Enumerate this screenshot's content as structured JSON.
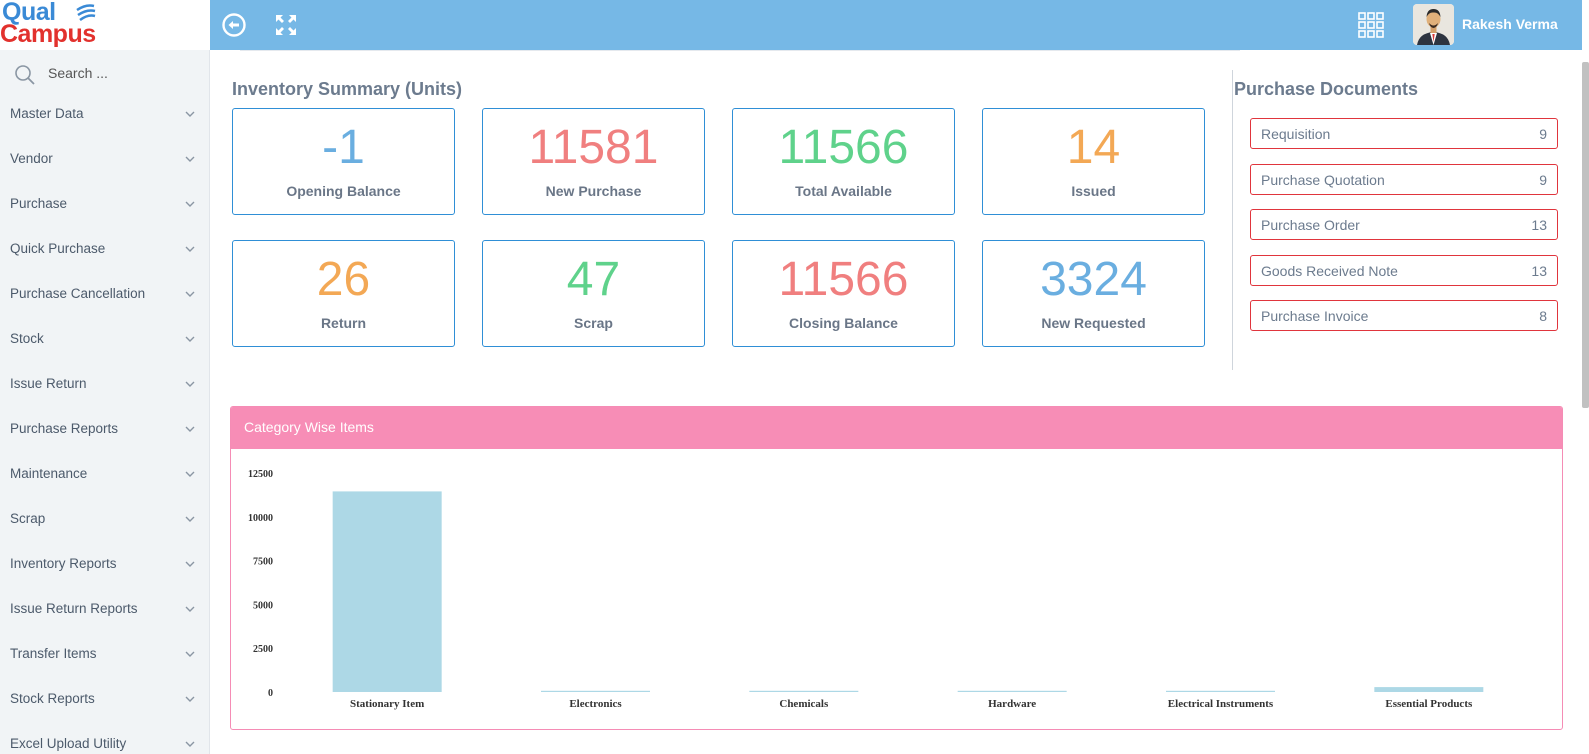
{
  "brand": {
    "line1": "Qual",
    "line2": "Campus"
  },
  "topbar": {
    "user_name": "Rakesh Verma"
  },
  "sidebar": {
    "search_placeholder": "Search ...",
    "items": [
      {
        "label": "Master Data"
      },
      {
        "label": "Vendor"
      },
      {
        "label": "Purchase"
      },
      {
        "label": "Quick Purchase"
      },
      {
        "label": "Purchase Cancellation"
      },
      {
        "label": "Stock"
      },
      {
        "label": "Issue Return"
      },
      {
        "label": "Purchase Reports"
      },
      {
        "label": "Maintenance"
      },
      {
        "label": "Scrap"
      },
      {
        "label": "Inventory Reports"
      },
      {
        "label": "Issue Return Reports"
      },
      {
        "label": "Transfer Items"
      },
      {
        "label": "Stock Reports"
      },
      {
        "label": "Excel Upload Utility"
      }
    ]
  },
  "inventory": {
    "title": "Inventory Summary (Units)",
    "cards": [
      {
        "value": "-1",
        "label": "Opening Balance",
        "color": "#6aaee0"
      },
      {
        "value": "11581",
        "label": "New Purchase",
        "color": "#f07f7f"
      },
      {
        "value": "11566",
        "label": "Total Available",
        "color": "#5fd28b"
      },
      {
        "value": "14",
        "label": "Issued",
        "color": "#f3a855"
      },
      {
        "value": "26",
        "label": "Return",
        "color": "#f3a855"
      },
      {
        "value": "47",
        "label": "Scrap",
        "color": "#5fd28b"
      },
      {
        "value": "11566",
        "label": "Closing Balance",
        "color": "#f07f7f"
      },
      {
        "value": "3324",
        "label": "New Requested",
        "color": "#6aaee0"
      }
    ]
  },
  "documents": {
    "title": "Purchase Documents",
    "items": [
      {
        "label": "Requisition",
        "count": "9"
      },
      {
        "label": "Purchase Quotation",
        "count": "9"
      },
      {
        "label": "Purchase Order",
        "count": "13"
      },
      {
        "label": "Goods Received Note",
        "count": "13"
      },
      {
        "label": "Purchase Invoice",
        "count": "8"
      }
    ]
  },
  "chart_panel": {
    "title": "Category Wise Items"
  },
  "chart_data": {
    "type": "bar",
    "title": "Category Wise Items",
    "categories": [
      "Stationary Item",
      "Electronics",
      "Chemicals",
      "Hardware",
      "Electrical Instruments",
      "Essential Products"
    ],
    "values": [
      11450,
      40,
      20,
      30,
      60,
      280
    ],
    "ylim": [
      0,
      12500
    ],
    "yticks": [
      0,
      2500,
      5000,
      7500,
      10000,
      12500
    ],
    "bar_color": "#add8e6",
    "grid": false,
    "xlabel": "",
    "ylabel": ""
  }
}
